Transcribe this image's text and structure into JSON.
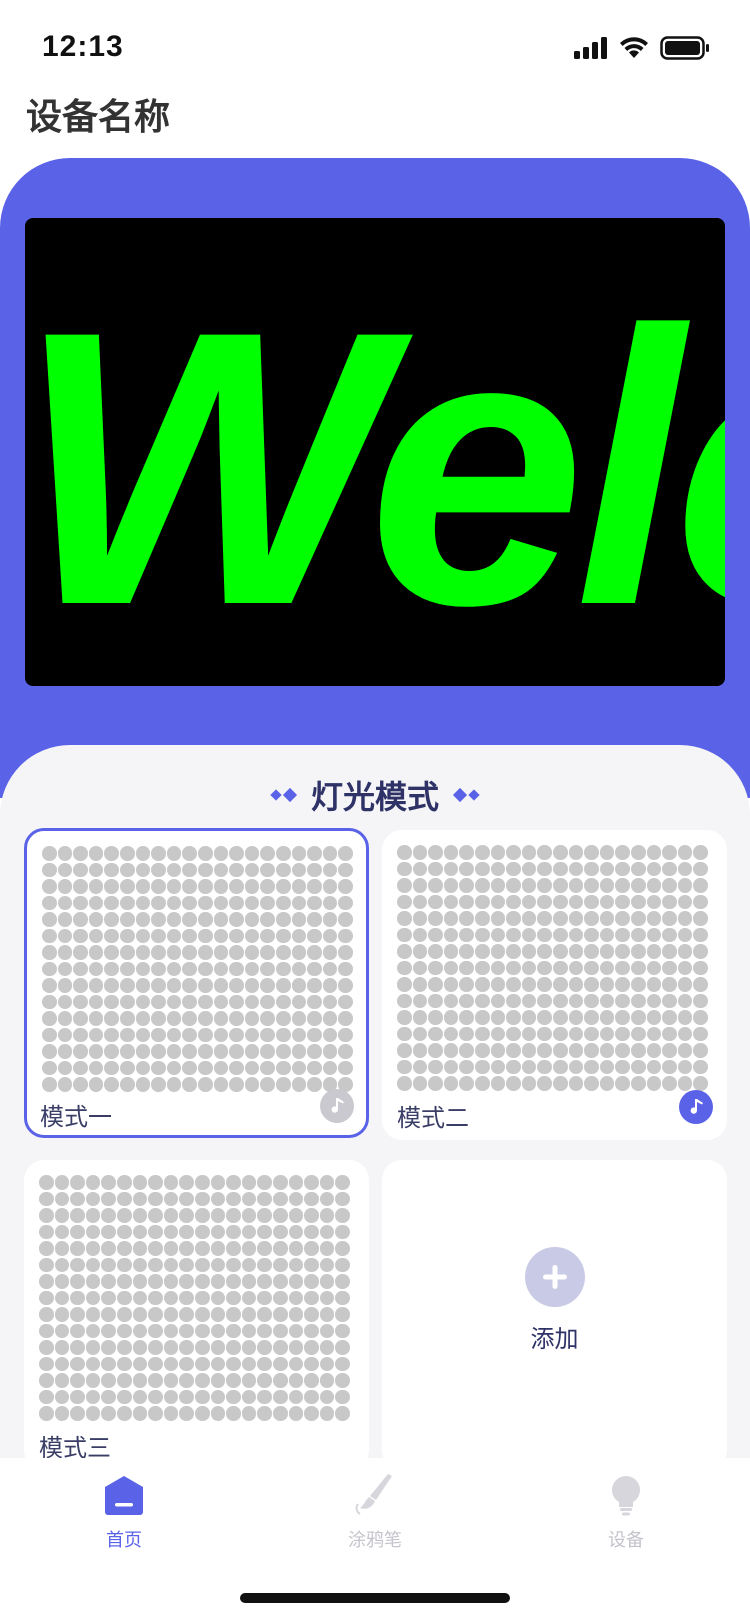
{
  "status_bar": {
    "time": "12:13",
    "icons": [
      "signal-icon",
      "wifi-icon",
      "battery-icon"
    ]
  },
  "header": {
    "title": "设备名称"
  },
  "led_preview": {
    "text": "Welc",
    "text_color": "#00ff00",
    "background": "#000000"
  },
  "section": {
    "title": "灯光模式"
  },
  "modes": [
    {
      "label": "模式一",
      "selected": true,
      "music": false
    },
    {
      "label": "模式二",
      "selected": false,
      "music": true
    },
    {
      "label": "模式三",
      "selected": false,
      "music": false
    }
  ],
  "add": {
    "label": "添加"
  },
  "tabs": [
    {
      "label": "首页",
      "icon": "home-icon",
      "active": true
    },
    {
      "label": "涂鸦笔",
      "icon": "brush-icon",
      "active": false
    },
    {
      "label": "设备",
      "icon": "bulb-icon",
      "active": false
    }
  ],
  "colors": {
    "accent": "#5a62e8",
    "panel": "#f5f5f7",
    "dot": "#c8c8c8",
    "text_dark": "#2e3266"
  }
}
